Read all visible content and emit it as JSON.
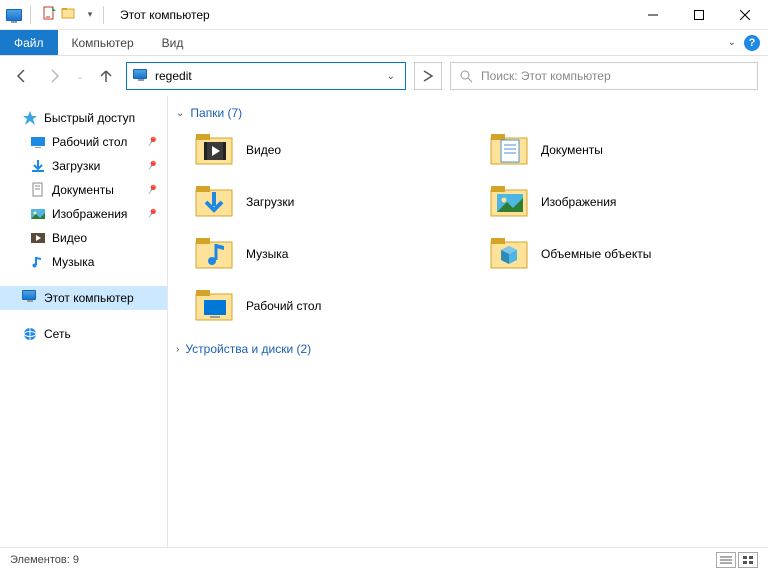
{
  "title": "Этот компьютер",
  "ribbon": {
    "file": "Файл",
    "computer": "Компьютер",
    "view": "Вид"
  },
  "nav": {
    "address_value": "regedit"
  },
  "search": {
    "placeholder": "Поиск: Этот компьютер"
  },
  "sidebar": {
    "quick_access": "Быстрый доступ",
    "desktop": "Рабочий стол",
    "downloads": "Загрузки",
    "documents": "Документы",
    "pictures": "Изображения",
    "videos": "Видео",
    "music": "Музыка",
    "this_pc": "Этот компьютер",
    "network": "Сеть"
  },
  "content": {
    "folders_header": "Папки (7)",
    "devices_header": "Устройства и диски (2)",
    "folders": {
      "video": "Видео",
      "documents": "Документы",
      "downloads": "Загрузки",
      "pictures": "Изображения",
      "music": "Музыка",
      "objects3d": "Объемные объекты",
      "desktop": "Рабочий стол"
    }
  },
  "status": {
    "items": "Элементов: 9"
  }
}
